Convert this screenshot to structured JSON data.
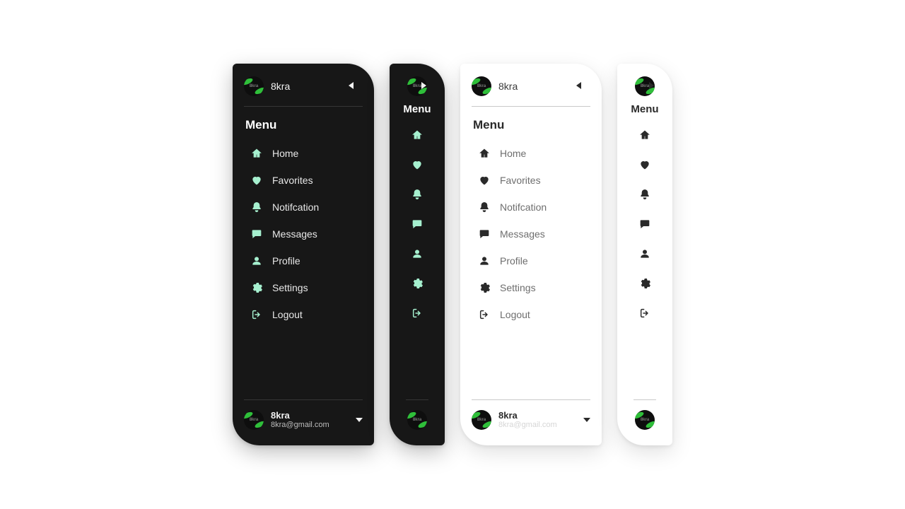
{
  "brand": "8kra",
  "avatar_text": "8kra",
  "menu_heading": "Menu",
  "items": [
    {
      "label": "Home",
      "icon": "home-icon"
    },
    {
      "label": "Favorites",
      "icon": "heart-icon"
    },
    {
      "label": "Notifcation",
      "icon": "bell-icon"
    },
    {
      "label": "Messages",
      "icon": "chat-icon"
    },
    {
      "label": "Profile",
      "icon": "user-icon"
    },
    {
      "label": "Settings",
      "icon": "gear-icon"
    },
    {
      "label": "Logout",
      "icon": "logout-icon"
    }
  ],
  "footer": {
    "name": "8kra",
    "email": "8kra@gmail.com"
  },
  "variants": [
    {
      "theme": "dark",
      "width": "wide",
      "toggle_icon": "triangle-left"
    },
    {
      "theme": "dark",
      "width": "narrow",
      "toggle_icon": "triangle-right"
    },
    {
      "theme": "light",
      "width": "wide",
      "toggle_icon": "triangle-left"
    },
    {
      "theme": "light",
      "width": "narrow",
      "toggle_icon": "triangle-right"
    }
  ],
  "colors": {
    "dark_bg": "#171717",
    "light_bg": "#ffffff",
    "accent_mint": "#a6f0cf",
    "leaf_green": "#2fbf3a"
  }
}
